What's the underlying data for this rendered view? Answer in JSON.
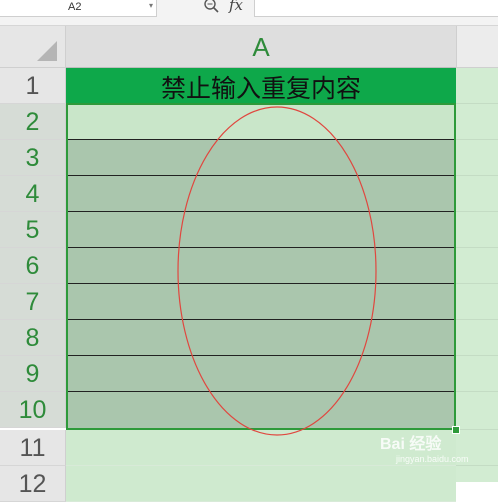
{
  "formula_bar": {
    "name_box": "A2",
    "fx_label": "fx",
    "formula": ""
  },
  "grid": {
    "column_header": "A",
    "title_cell": "禁止输入重复内容",
    "rows": [
      "1",
      "2",
      "3",
      "4",
      "5",
      "6",
      "7",
      "8",
      "9",
      "10",
      "11",
      "12"
    ]
  },
  "watermark": {
    "brand": "Bai 经验",
    "url": "jingyan.baidu.com"
  },
  "colors": {
    "title_fill": "#0ea84a",
    "selection_fill": "#aac6ad",
    "selection_border": "#2e9a3a",
    "ellipse_stroke": "#e0473f"
  }
}
